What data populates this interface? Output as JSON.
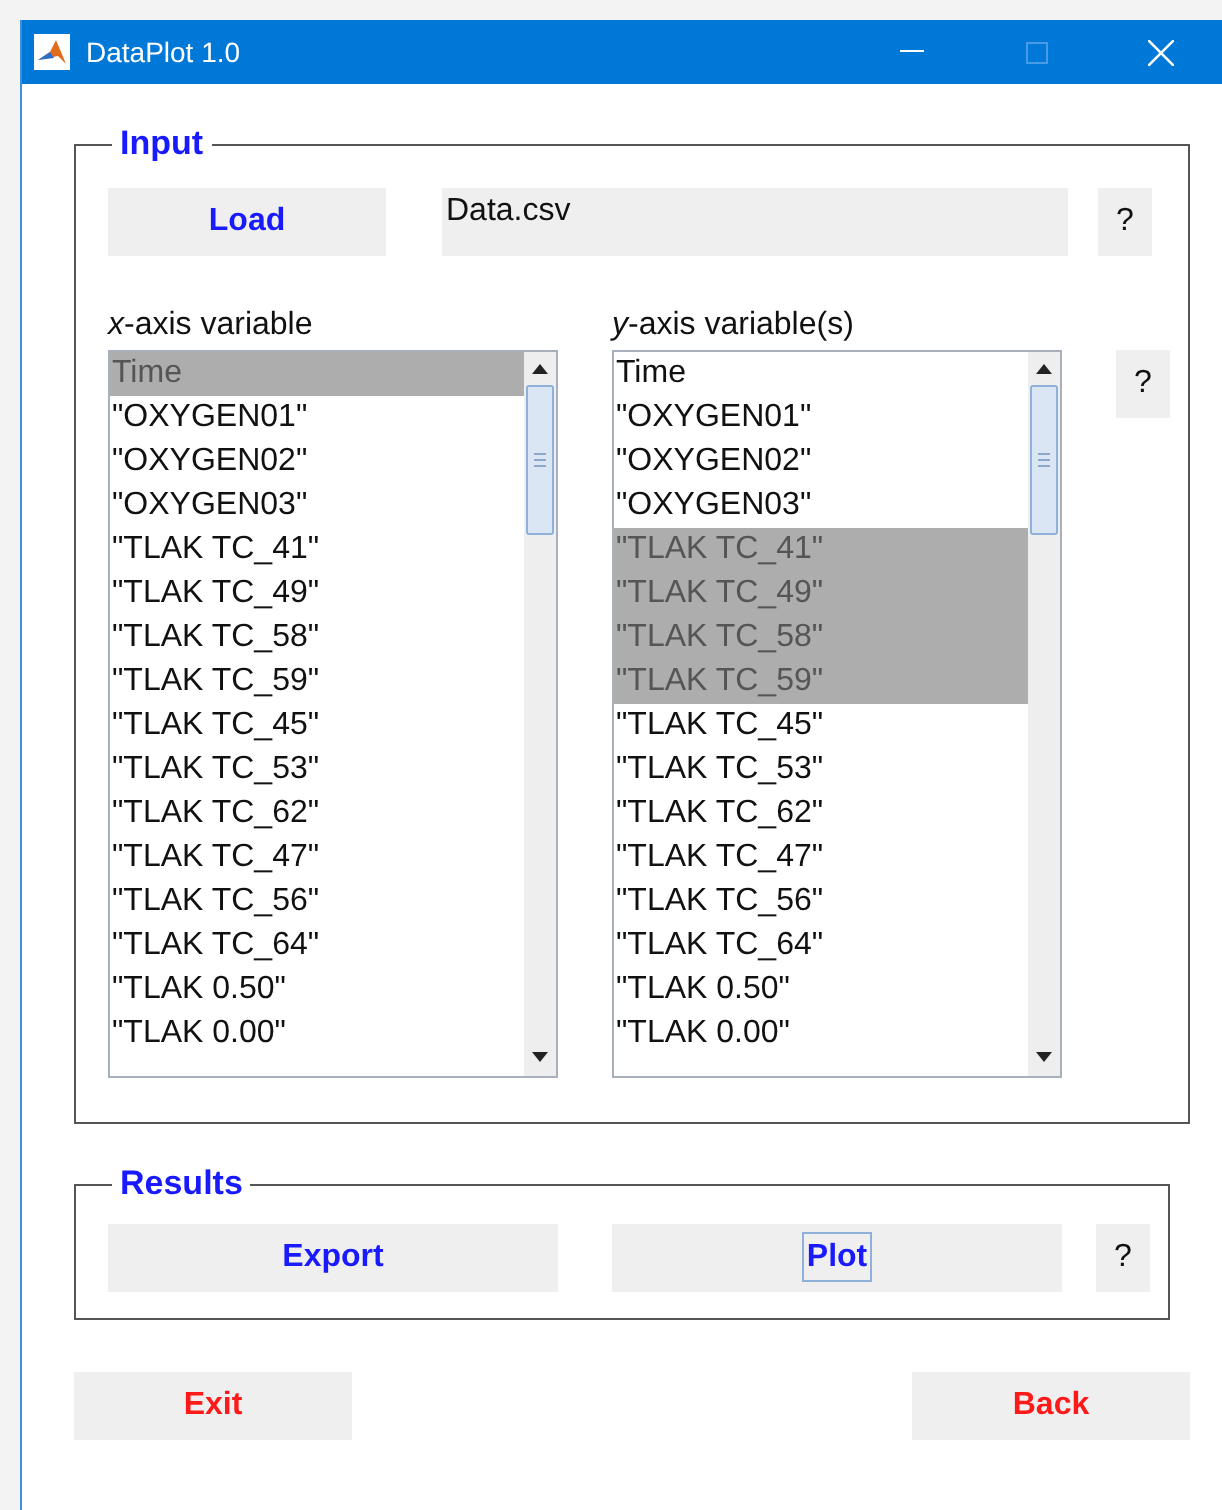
{
  "window": {
    "title": "DataPlot 1.0"
  },
  "input": {
    "legend": "Input",
    "load_button": "Load",
    "file_name": "Data.csv",
    "help_button": "?",
    "lists": [
      {
        "label": "*x*-axis variable",
        "items": [
          {
            "text": "Time",
            "selected": true
          },
          {
            "text": "\"OXYGEN01\"",
            "selected": false
          },
          {
            "text": "\"OXYGEN02\"",
            "selected": false
          },
          {
            "text": "\"OXYGEN03\"",
            "selected": false
          },
          {
            "text": "\"TLAK TC_41\"",
            "selected": false
          },
          {
            "text": "\"TLAK TC_49\"",
            "selected": false
          },
          {
            "text": "\"TLAK TC_58\"",
            "selected": false
          },
          {
            "text": "\"TLAK TC_59\"",
            "selected": false
          },
          {
            "text": "\"TLAK TC_45\"",
            "selected": false
          },
          {
            "text": "\"TLAK TC_53\"",
            "selected": false
          },
          {
            "text": "\"TLAK TC_62\"",
            "selected": false
          },
          {
            "text": "\"TLAK TC_47\"",
            "selected": false
          },
          {
            "text": "\"TLAK TC_56\"",
            "selected": false
          },
          {
            "text": "\"TLAK TC_64\"",
            "selected": false
          },
          {
            "text": "\"TLAK 0.50\"",
            "selected": false
          },
          {
            "text": "\"TLAK 0.00\"",
            "selected": false
          }
        ]
      },
      {
        "label": "*y*-axis variable(s)",
        "help_button": "?",
        "items": [
          {
            "text": "Time",
            "selected": false
          },
          {
            "text": "\"OXYGEN01\"",
            "selected": false
          },
          {
            "text": "\"OXYGEN02\"",
            "selected": false
          },
          {
            "text": "\"OXYGEN03\"",
            "selected": false
          },
          {
            "text": "\"TLAK TC_41\"",
            "selected": true
          },
          {
            "text": "\"TLAK TC_49\"",
            "selected": true
          },
          {
            "text": "\"TLAK TC_58\"",
            "selected": true
          },
          {
            "text": "\"TLAK TC_59\"",
            "selected": true
          },
          {
            "text": "\"TLAK TC_45\"",
            "selected": false
          },
          {
            "text": "\"TLAK TC_53\"",
            "selected": false
          },
          {
            "text": "\"TLAK TC_62\"",
            "selected": false
          },
          {
            "text": "\"TLAK TC_47\"",
            "selected": false
          },
          {
            "text": "\"TLAK TC_56\"",
            "selected": false
          },
          {
            "text": "\"TLAK TC_64\"",
            "selected": false
          },
          {
            "text": "\"TLAK 0.50\"",
            "selected": false
          },
          {
            "text": "\"TLAK 0.00\"",
            "selected": false
          }
        ]
      }
    ]
  },
  "results": {
    "legend": "Results",
    "buttons": [
      {
        "label": "Export",
        "focused": false
      },
      {
        "label": "Plot",
        "focused": true
      }
    ],
    "help_button": "?"
  },
  "footer": {
    "buttons": [
      {
        "label": "Exit"
      },
      {
        "label": "Back"
      }
    ]
  }
}
